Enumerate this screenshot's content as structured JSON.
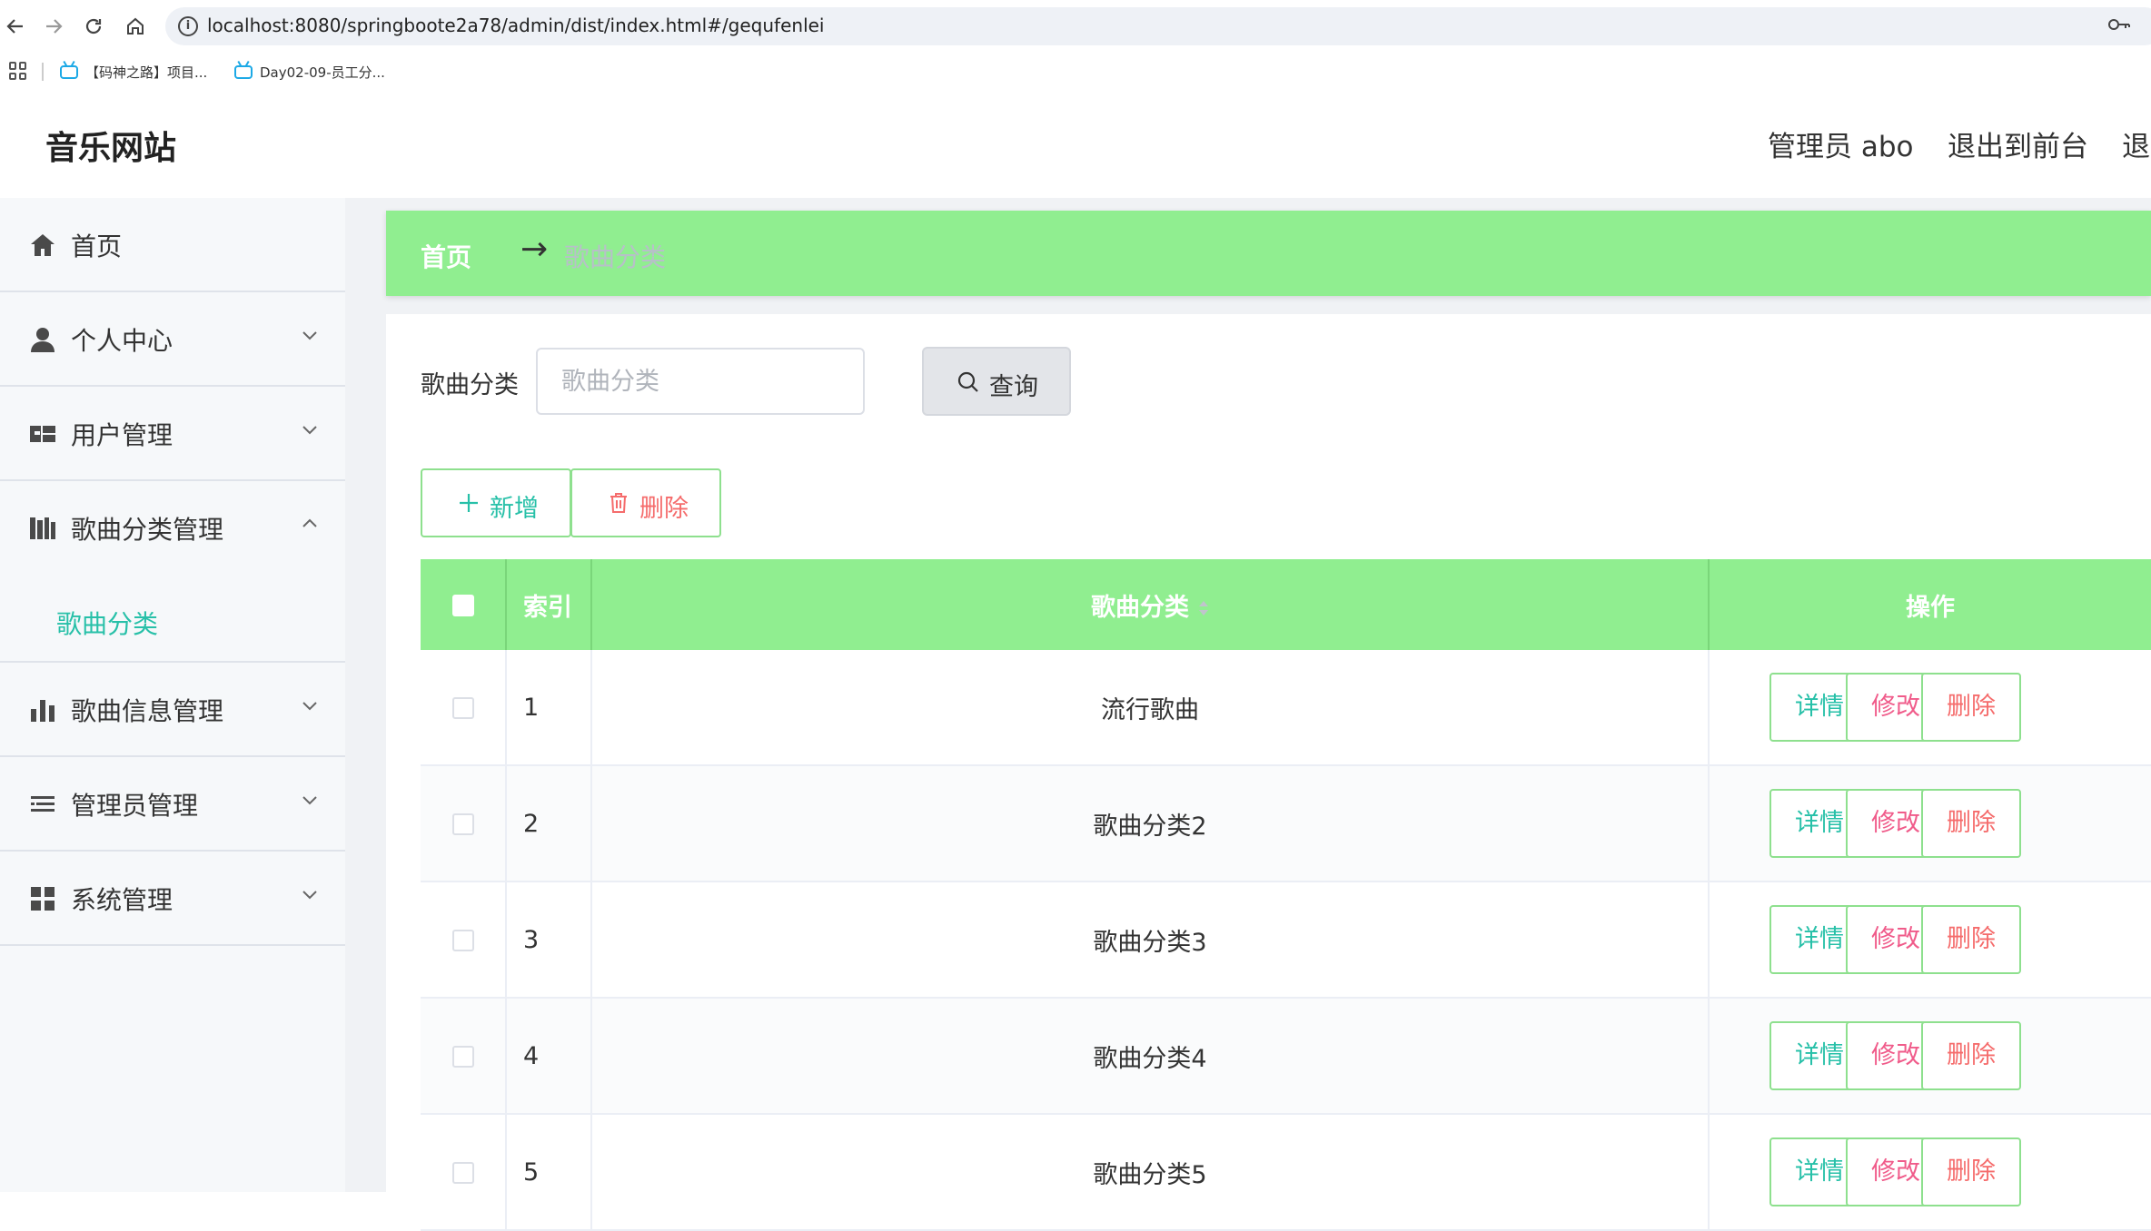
{
  "browser": {
    "url": "localhost:8080/springboote2a78/admin/dist/index.html#/gequfenlei",
    "bookmarks": [
      "【码神之路】项目...",
      "Day02-09-员工分..."
    ]
  },
  "header": {
    "title": "音乐网站",
    "admin_label": "管理员 abo",
    "front_label": "退出到前台",
    "logout_label": "退"
  },
  "sidebar": {
    "items": [
      {
        "label": "首页",
        "icon": "home-icon"
      },
      {
        "label": "个人中心",
        "icon": "user-icon"
      },
      {
        "label": "用户管理",
        "icon": "users-icon"
      },
      {
        "label": "歌曲分类管理",
        "icon": "books-icon"
      },
      {
        "label": "歌曲信息管理",
        "icon": "bar-chart-icon"
      },
      {
        "label": "管理员管理",
        "icon": "list-icon"
      },
      {
        "label": "系统管理",
        "icon": "grid-icon"
      }
    ],
    "active_sub": "歌曲分类"
  },
  "breadcrumb": {
    "home": "首页",
    "arrow": "→",
    "current": "歌曲分类"
  },
  "search": {
    "label": "歌曲分类",
    "placeholder": "歌曲分类",
    "value": "",
    "button_label": "查询"
  },
  "actions": {
    "add_label": "新增",
    "delete_label": "删除"
  },
  "table": {
    "headers": {
      "index": "索引",
      "category": "歌曲分类",
      "ops": "操作"
    },
    "rows": [
      {
        "index": "1",
        "category": "流行歌曲"
      },
      {
        "index": "2",
        "category": "歌曲分类2"
      },
      {
        "index": "3",
        "category": "歌曲分类3"
      },
      {
        "index": "4",
        "category": "歌曲分类4"
      },
      {
        "index": "5",
        "category": "歌曲分类5"
      }
    ],
    "op_labels": {
      "detail": "详情",
      "edit": "修改",
      "delete": "删除"
    }
  },
  "colors": {
    "accent_green": "#90ee90",
    "teal": "#27c0a8",
    "danger": "#f56c6c",
    "edit_pink": "#f05b8a"
  }
}
